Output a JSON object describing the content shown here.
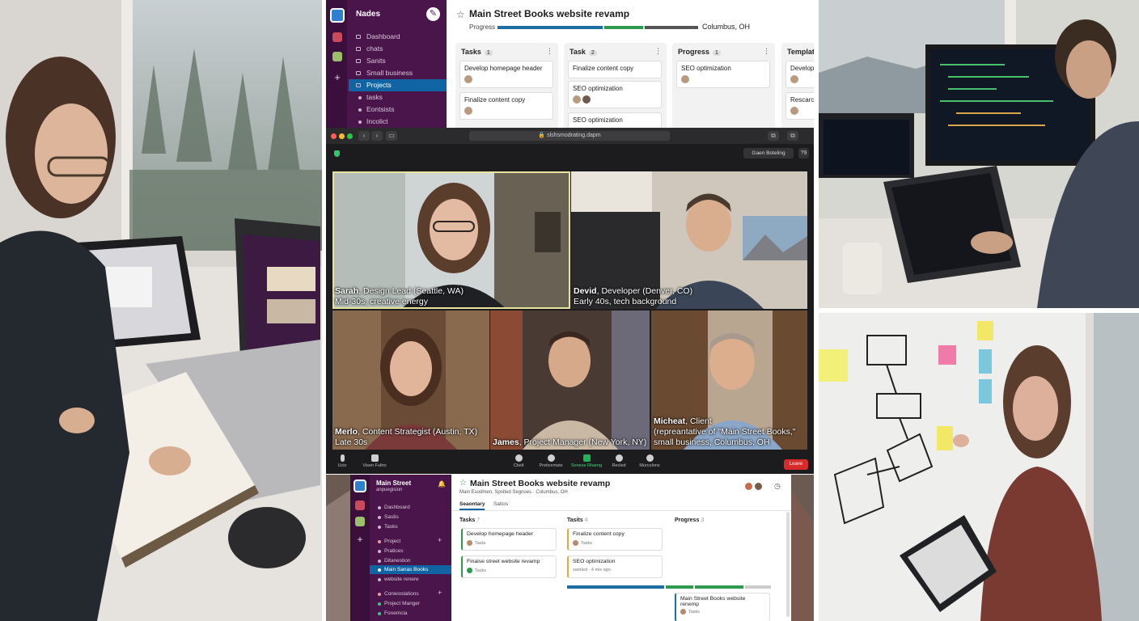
{
  "top_workspace": {
    "workspace_name": "Nades",
    "sidebar_items": [
      {
        "label": "Dashboard"
      },
      {
        "label": "chats"
      },
      {
        "label": "Sanits"
      },
      {
        "label": "Small business"
      },
      {
        "label": "Projects"
      },
      {
        "label": "tasks"
      },
      {
        "label": "Eontsists"
      },
      {
        "label": "Incolict"
      }
    ],
    "active_index": 4,
    "project_title": "Main Street Books website revamp",
    "progress_label": "Progress",
    "location": "Columbus, OH",
    "columns": [
      {
        "title": "Tasks",
        "count": "1",
        "cards": [
          "Develop homepage header",
          "Finalize content copy"
        ]
      },
      {
        "title": "Task",
        "count": "2",
        "cards": [
          "Finalize content copy",
          "SEO optimization",
          "SEO optimization"
        ]
      },
      {
        "title": "Progress",
        "count": "1",
        "cards": [
          "SEO optimization"
        ]
      },
      {
        "title": "Templat",
        "count": "",
        "cards": [
          "Develop",
          "Rescarc"
        ]
      }
    ],
    "colors": {
      "sidebar": "#4a154b",
      "active": "#1164a3"
    }
  },
  "call": {
    "url": "slshsmodrating.dapm",
    "gallery_label": "Gaen Boteling",
    "help_label": "?9",
    "participants": [
      {
        "name": "Sarah",
        "role": "Design Lead (Seattle, WA)",
        "line2": "Mid-30s, creative energy"
      },
      {
        "name": "Devid",
        "role": "Developer (Denver, CO)",
        "line2": "Early 40s, tech background"
      },
      {
        "name": "Merlo",
        "role": "Content Strategist (Austin, TX)",
        "line2": "Late 30s"
      },
      {
        "name": "James",
        "role": "Project Manager (New York, NY)",
        "line2": ""
      },
      {
        "name": "Micheat",
        "role": "Client",
        "line2": "(repreantative of \"Main Street Books,\"",
        "line3": "small business, Columbus, OH"
      }
    ],
    "toolbar": {
      "buttons": [
        {
          "label": "Ucio"
        },
        {
          "label": "Visen Fultro"
        },
        {
          "label": "Cbelt"
        },
        {
          "label": "Preticemats"
        },
        {
          "label": "Sonese Rharng"
        },
        {
          "label": "Recled"
        },
        {
          "label": "Murcolons"
        }
      ],
      "leave_label": "Leave"
    }
  },
  "bottom_workspace": {
    "workspace_name": "Main Street",
    "workspace_sub": "anpuegision",
    "sidebar_items": [
      {
        "label": "Dashboard"
      },
      {
        "label": "Sastis"
      },
      {
        "label": "Tasks"
      },
      {
        "label": "Project"
      },
      {
        "label": "Pratices"
      },
      {
        "label": "Ditanestion"
      },
      {
        "label": "Main Sanas Books"
      },
      {
        "label": "website renere"
      },
      {
        "label": "Conwostations"
      },
      {
        "label": "Project Manger"
      },
      {
        "label": "Fonemcia"
      }
    ],
    "active_index": 6,
    "project_title": "Main Street Books website revamp",
    "breadcrumb": "Main Esodmen, Spnited Segnoes · Columbus, OH",
    "tabs": [
      "Seaontary",
      "Satios"
    ],
    "columns": [
      {
        "title": "Tasks",
        "count": "7",
        "cards": [
          {
            "title": "Develop homepage header",
            "meta": "Tasta"
          },
          {
            "title": "Finaise street website revamp",
            "meta": "Tasks"
          }
        ]
      },
      {
        "title": "Tasits",
        "count": "4",
        "cards": [
          {
            "title": "Finalize content copy",
            "meta": "Tasks"
          },
          {
            "title": "SEO optimization",
            "meta": "samted  · 4 mis ago"
          }
        ]
      },
      {
        "title": "Progress",
        "count": "3",
        "cards": [
          {
            "title": "Main Street Books website renemp",
            "meta": "Tasks"
          }
        ]
      }
    ]
  }
}
